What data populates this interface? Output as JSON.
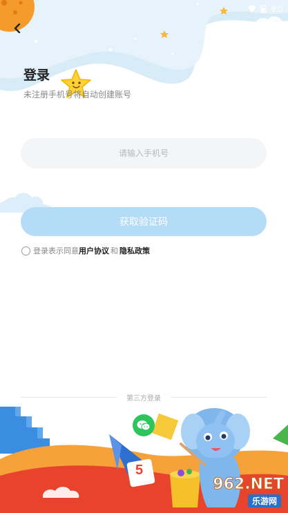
{
  "status_bar": {
    "time": "9:0"
  },
  "header": {
    "back_icon": "chevron-left-icon",
    "title": "登录",
    "subtitle": "未注册手机号将自动创建账号"
  },
  "form": {
    "phone_placeholder": "请输入手机号",
    "phone_value": "",
    "get_code_label": "获取验证码"
  },
  "agreement": {
    "prefix": "登录表示同意",
    "user_agreement": "用户协议",
    "and": "和",
    "privacy_policy": "隐私政策"
  },
  "third_party": {
    "label": "第三方登录",
    "wechat_icon": "wechat-icon"
  },
  "scene": {
    "dice_number": "5"
  },
  "watermark": {
    "top": "962.NET",
    "bottom": "乐游网"
  },
  "colors": {
    "primary_button": "#b4dcf6",
    "input_bg": "#f4f5f7",
    "wechat": "#2ec55f",
    "top_wave": "#d8ecf8"
  }
}
